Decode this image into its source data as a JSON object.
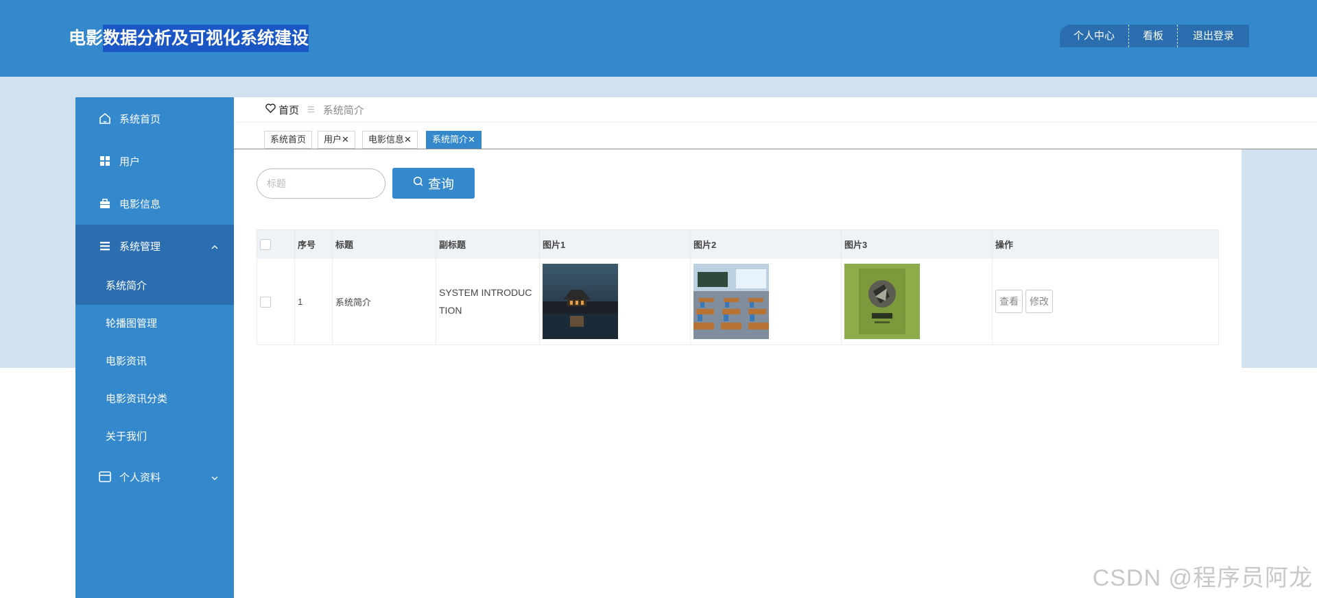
{
  "header": {
    "app_title_prefix": "电影",
    "app_title_selected": "数据分析及可视化系统建设",
    "nav": [
      "个人中心",
      "看板",
      "退出登录"
    ]
  },
  "sidebar": {
    "items": [
      {
        "label": "系统首页",
        "icon": "home-icon"
      },
      {
        "label": "用户",
        "icon": "grid-icon"
      },
      {
        "label": "电影信息",
        "icon": "briefcase-icon"
      },
      {
        "label": "系统管理",
        "icon": "menu-icon"
      },
      {
        "label": "个人资料",
        "icon": "card-icon"
      }
    ],
    "submenu": [
      "系统简介",
      "轮播图管理",
      "电影资讯",
      "电影资讯分类",
      "关于我们"
    ]
  },
  "breadcrumb": {
    "home": "首页",
    "current": "系统简介"
  },
  "tabs": [
    "系统首页",
    "用户",
    "电影信息",
    "系统简介"
  ],
  "search": {
    "placeholder": "标题",
    "button": "查询"
  },
  "table": {
    "headers": [
      "序号",
      "标题",
      "副标题",
      "图片1",
      "图片2",
      "图片3",
      "操作"
    ],
    "rows": [
      {
        "index": "1",
        "title": "系统简介",
        "subtitle": "SYSTEM INTRODUCTION",
        "view": "查看",
        "edit": "修改"
      }
    ]
  },
  "watermark": "CSDN @程序员阿龙",
  "colors": {
    "primary": "#3488cc",
    "primary_dark": "#2a6eb0",
    "band": "#d2e1ef"
  }
}
